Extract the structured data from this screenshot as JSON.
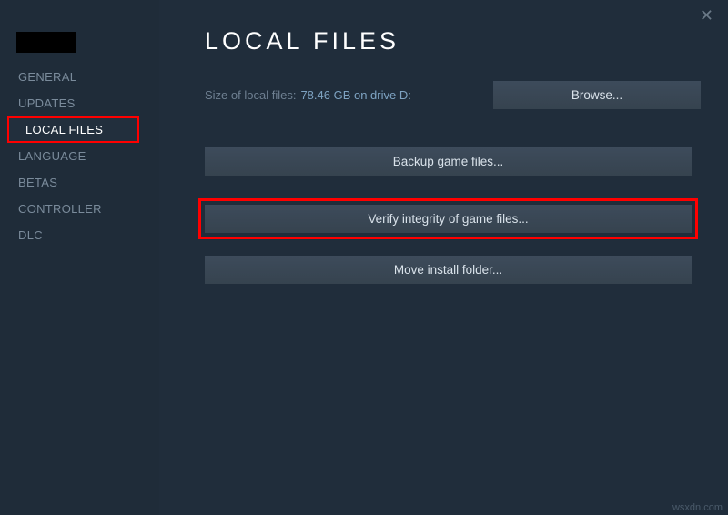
{
  "sidebar": {
    "items": [
      {
        "label": "GENERAL"
      },
      {
        "label": "UPDATES"
      },
      {
        "label": "LOCAL FILES"
      },
      {
        "label": "LANGUAGE"
      },
      {
        "label": "BETAS"
      },
      {
        "label": "CONTROLLER"
      },
      {
        "label": "DLC"
      }
    ]
  },
  "main": {
    "title": "LOCAL FILES",
    "size_label": "Size of local files:",
    "size_value": "78.46 GB on drive D:",
    "browse_label": "Browse...",
    "backup_label": "Backup game files...",
    "verify_label": "Verify integrity of game files...",
    "move_label": "Move install folder..."
  },
  "close_label": "✕",
  "watermark": "wsxdn.com"
}
